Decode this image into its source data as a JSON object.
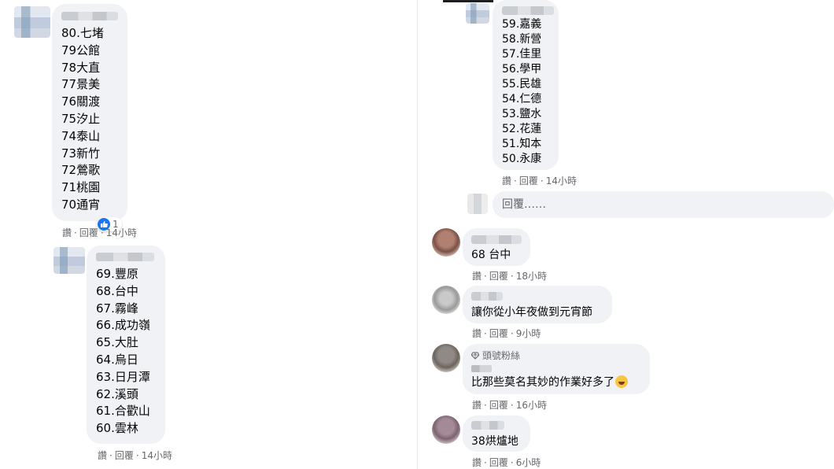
{
  "left": {
    "comment1": {
      "lines": [
        "80.七堵",
        "79公館",
        "78大直",
        "77景美",
        "76關渡",
        "75汐止",
        "74泰山",
        "73新竹",
        "72鶯歌",
        "71桃園",
        "70通宵"
      ],
      "like_count": "1",
      "actions": {
        "like": "讚",
        "reply": "回覆",
        "time": "14小時"
      }
    },
    "comment2": {
      "lines": [
        "69.豐原",
        "68.台中",
        "67.霧峰",
        "66.成功嶺",
        "65.大肚",
        "64.烏日",
        "63.日月潭",
        "62.溪頭",
        "61.合歡山",
        "60.雲林"
      ],
      "actions": {
        "like": "讚",
        "reply": "回覆",
        "time": "14小時"
      }
    }
  },
  "right": {
    "comment3": {
      "lines": [
        "59.嘉義",
        "58.新營",
        "57.佳里",
        "56.學甲",
        "55.民雄",
        "54.仁德",
        "53.鹽水",
        "52.花蓮",
        "51.知本",
        "50.永康"
      ],
      "actions": {
        "like": "讚",
        "reply": "回覆",
        "time": "14小時"
      }
    },
    "reply_box": {
      "placeholder": "回覆……"
    },
    "comment4": {
      "text": "68 台中",
      "actions": {
        "like": "讚",
        "reply": "回覆",
        "time": "18小時"
      }
    },
    "comment5": {
      "text": "讓你從小年夜做到元宵節",
      "actions": {
        "like": "讚",
        "reply": "回覆",
        "time": "9小時"
      }
    },
    "comment6": {
      "badge": "頭號粉絲",
      "text": "比那些莫名其妙的作業好多了",
      "emoji": "laughing-face-icon",
      "actions": {
        "like": "讚",
        "reply": "回覆",
        "time": "16小時"
      }
    },
    "comment7": {
      "text": "38烘爐地",
      "actions": {
        "like": "讚",
        "reply": "回覆",
        "time": "6小時"
      }
    }
  },
  "colors": {
    "bubble": "#f0f2f5",
    "meta": "#65676b",
    "like_blue": "#1877f2"
  }
}
